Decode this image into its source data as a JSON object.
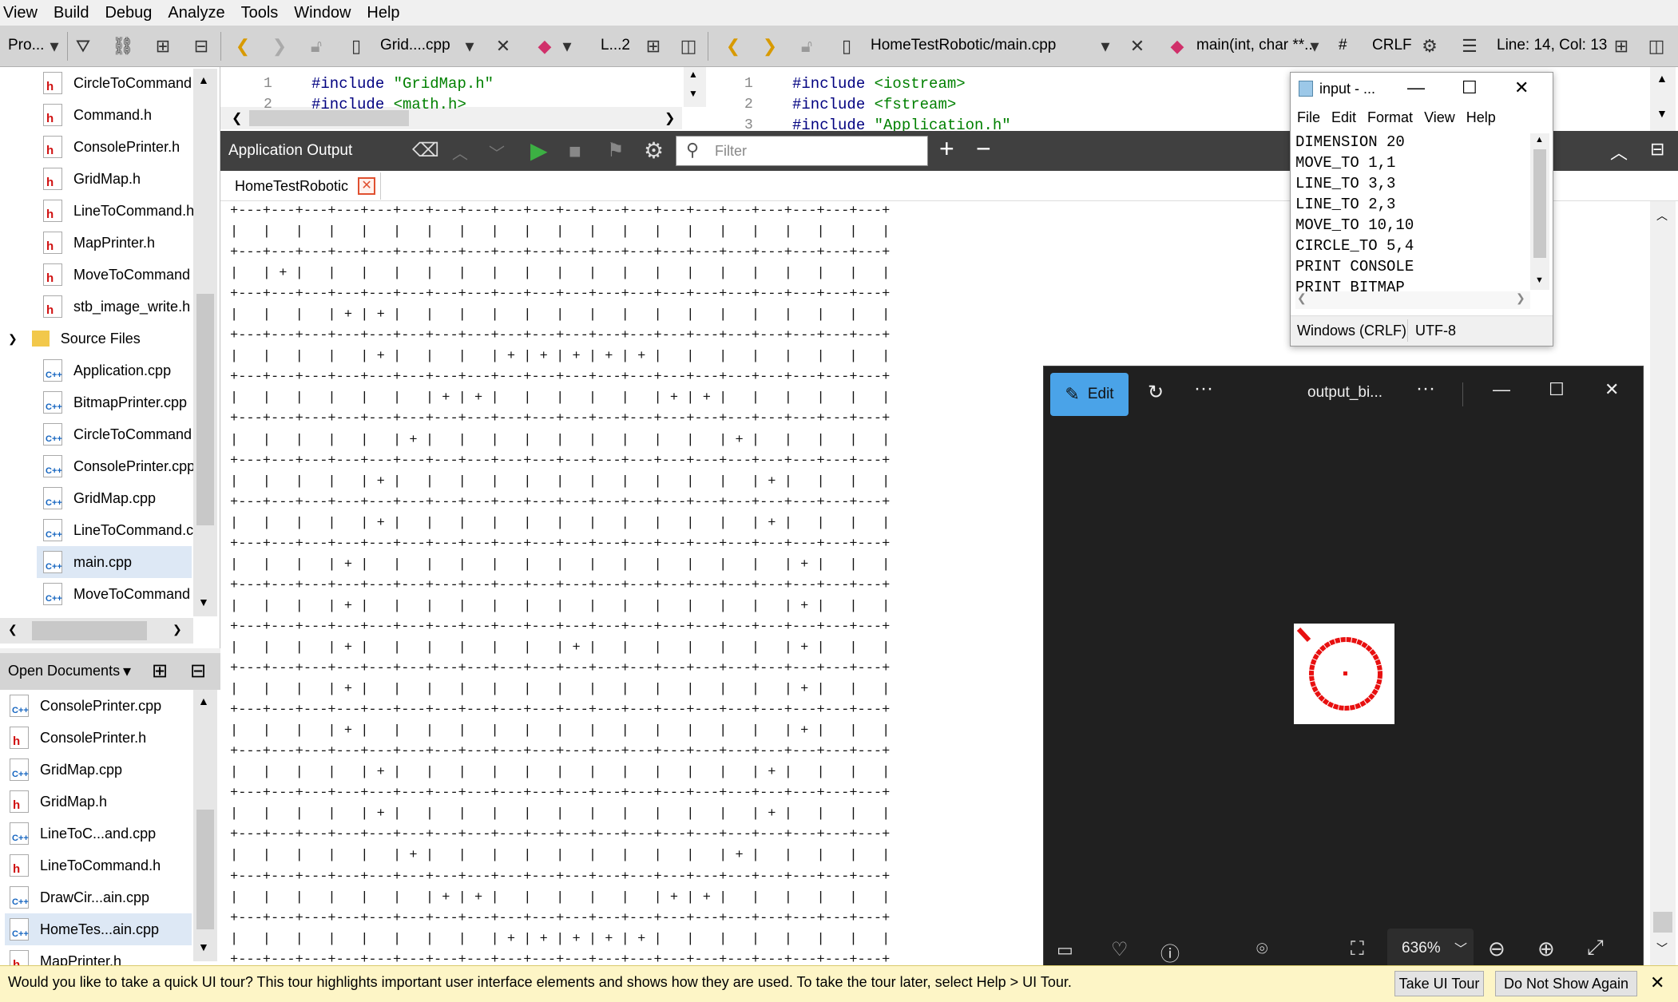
{
  "menu": [
    "View",
    "Build",
    "Debug",
    "Analyze",
    "Tools",
    "Window",
    "Help"
  ],
  "toolbar": {
    "projects_label": "Pro...",
    "left_file": "Grid....cpp",
    "left_line": "L...2",
    "right_file": "HomeTestRobotic/main.cpp",
    "right_symbol": "main(int, char **...",
    "hash": "#",
    "line_ending": "CRLF",
    "position": "Line: 14, Col: 13"
  },
  "project_tree": {
    "headers": [
      "CircleToCommand",
      "Command.h",
      "ConsolePrinter.h",
      "GridMap.h",
      "LineToCommand.h",
      "MapPrinter.h",
      "MoveToCommand",
      "stb_image_write.h"
    ],
    "source_folder": "Source Files",
    "sources": [
      "Application.cpp",
      "BitmapPrinter.cpp",
      "CircleToCommand",
      "ConsolePrinter.cpp",
      "GridMap.cpp",
      "LineToCommand.c",
      "main.cpp",
      "MoveToCommand"
    ]
  },
  "open_documents": {
    "title": "Open Documents",
    "items": [
      {
        "name": "ConsolePrinter.cpp",
        "type": "cpp"
      },
      {
        "name": "ConsolePrinter.h",
        "type": "h"
      },
      {
        "name": "GridMap.cpp",
        "type": "cpp"
      },
      {
        "name": "GridMap.h",
        "type": "h"
      },
      {
        "name": "LineToC...and.cpp",
        "type": "cpp"
      },
      {
        "name": "LineToCommand.h",
        "type": "h"
      },
      {
        "name": "DrawCir...ain.cpp",
        "type": "cpp"
      },
      {
        "name": "HomeTes...ain.cpp",
        "type": "cpp"
      },
      {
        "name": "MapPrinter.h",
        "type": "h"
      }
    ]
  },
  "editor_left": {
    "lines": [
      {
        "n": "1",
        "pre": "#include ",
        "str": "\"GridMap.h\""
      },
      {
        "n": "2",
        "pre": "#include ",
        "str": "<math.h>"
      }
    ]
  },
  "editor_right": {
    "lines": [
      {
        "n": "1",
        "pre": "#include ",
        "str": "<iostream>"
      },
      {
        "n": "2",
        "pre": "#include ",
        "str": "<fstream>"
      },
      {
        "n": "3",
        "pre": "#include ",
        "str": "\"Application.h\""
      }
    ]
  },
  "output": {
    "title": "Application Output",
    "filter_placeholder": "Filter",
    "tab": "HomeTestRobotic",
    "grid_size": 20,
    "plus_rows": [
      [],
      [
        1
      ],
      [
        3,
        4
      ],
      [
        4,
        8,
        9,
        10,
        11,
        12
      ],
      [
        6,
        7,
        13,
        14
      ],
      [
        5,
        15
      ],
      [
        4,
        16
      ],
      [
        4,
        16
      ],
      [
        3,
        17
      ],
      [
        3,
        17
      ],
      [
        3,
        10,
        17
      ],
      [
        3,
        17
      ],
      [
        3,
        17
      ],
      [
        4,
        16
      ],
      [
        4,
        16
      ],
      [
        5,
        15
      ],
      [
        6,
        7,
        13,
        14
      ],
      [
        8,
        9,
        10,
        11,
        12
      ]
    ]
  },
  "notepad": {
    "title": "input - ...",
    "menu": [
      "File",
      "Edit",
      "Format",
      "View",
      "Help"
    ],
    "lines": [
      "DIMENSION 20",
      "MOVE_TO 1,1",
      "LINE_TO 3,3",
      "LINE_TO 2,3",
      "MOVE_TO 10,10",
      "CIRCLE_TO 5,4",
      "PRINT CONSOLE",
      "PRINT BITMAP"
    ],
    "status_eol": "Windows (CRLF)",
    "status_enc": "UTF-8"
  },
  "photos": {
    "edit_label": "Edit",
    "title": "output_bi...",
    "zoom": "636%",
    "accent": "#4aa3e8"
  },
  "tour": {
    "message": "Would you like to take a quick UI tour? This tour highlights important user interface elements and shows how they are used. To take the tour later, select Help > UI Tour.",
    "take_label": "Take UI Tour",
    "dismiss_label": "Do Not Show Again"
  }
}
